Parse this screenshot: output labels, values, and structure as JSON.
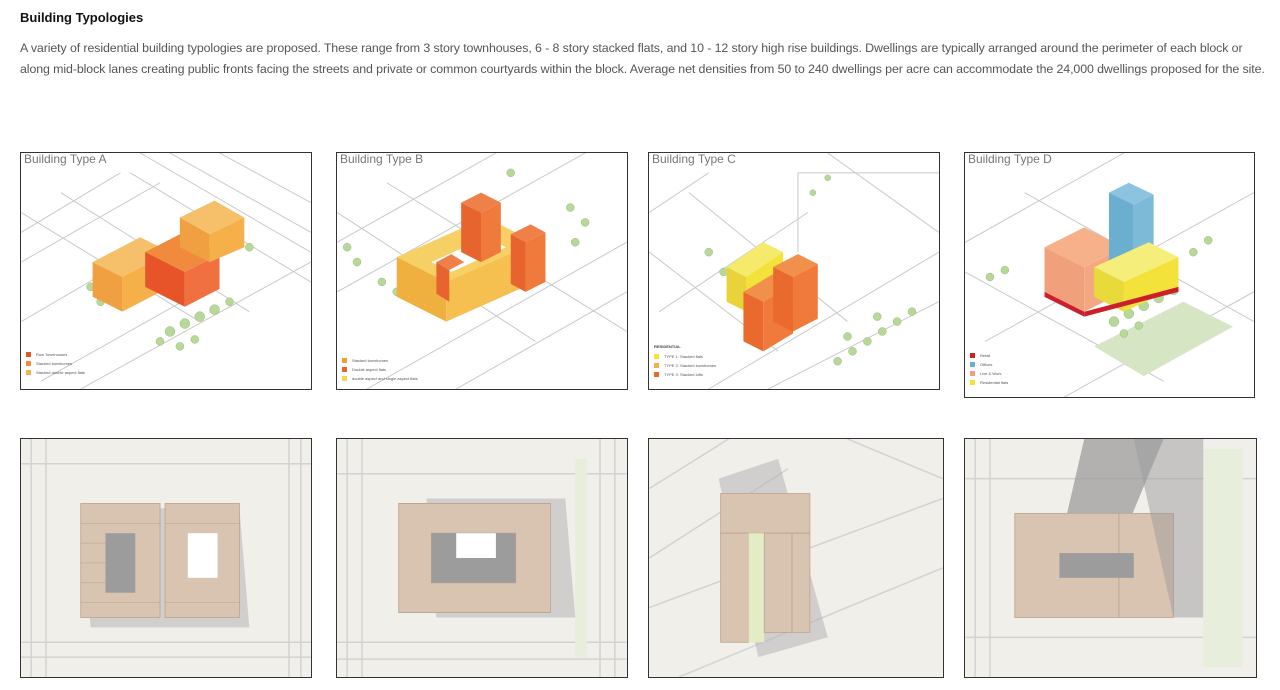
{
  "page": {
    "title": "Building Typologies",
    "description": "A variety of residential building typologies are proposed. These range from 3 story townhouses, 6 - 8 story stacked flats, and 10 - 12 story high rise buildings. Dwellings are typically arranged around the perimeter of each block or along mid-block lanes creating public fronts facing the streets and private or common courtyards within the block. Average net densities from 50 to 240 dwellings per acre can accommodate the 24,000 dwellings proposed for the site."
  },
  "panels": [
    {
      "label": "Building Type A",
      "legend": [
        {
          "color": "#e8542a",
          "text": "Row Townhouses"
        },
        {
          "color": "#f08a3c",
          "text": "Stacked townhomes"
        },
        {
          "color": "#f6b04a",
          "text": "Stacked double aspect flats"
        }
      ]
    },
    {
      "label": "Building Type B",
      "legend": [
        {
          "color": "#f0a02c",
          "text": "Stacked townhomes"
        },
        {
          "color": "#e8642e",
          "text": "Double aspect flats"
        },
        {
          "color": "#f6d64a",
          "text": "double aspect and single aspect flats"
        }
      ]
    },
    {
      "label": "Building Type C",
      "legend_heading": "RESIDENTIAL",
      "legend": [
        {
          "color": "#f2e23a",
          "text": "TYPE 1: Stacked flats"
        },
        {
          "color": "#f6b04a",
          "text": "TYPE 2: Stacked townhomes"
        },
        {
          "color": "#ea6a2e",
          "text": "TYPE 3: Stacked lofts"
        }
      ]
    },
    {
      "label": "Building Type D",
      "legend": [
        {
          "color": "#cc1f2a",
          "text": "Retail"
        },
        {
          "color": "#6aaed0",
          "text": "Offices"
        },
        {
          "color": "#f0a07a",
          "text": "Live & Work"
        },
        {
          "color": "#f2e23a",
          "text": "Residential flats"
        }
      ]
    }
  ],
  "colors": {
    "plan_building": "#d8c4b0",
    "plan_shadow": "#9c9c9c",
    "street_lines": "#bdbdbd",
    "tree_green": "#b8d89a"
  }
}
